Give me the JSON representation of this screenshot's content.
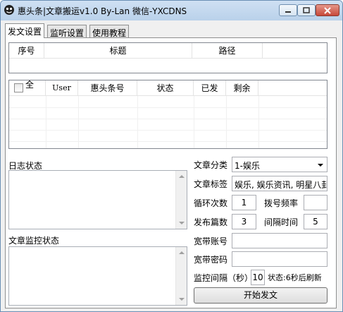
{
  "window": {
    "title": "惠头条|文章搬运v1.0 By-Lan 微信-YXCDNS"
  },
  "tabs": [
    {
      "label": "发文设置"
    },
    {
      "label": "监听设置"
    },
    {
      "label": "使用教程"
    }
  ],
  "article_list": {
    "columns": [
      "序号",
      "标题",
      "路径"
    ]
  },
  "account_list": {
    "select_all_label": "全",
    "columns": [
      "User",
      "惠头条号",
      "状态",
      "已发",
      "剩余"
    ]
  },
  "log": {
    "label": "日志状态"
  },
  "monitor_log": {
    "label": "文章监控状态"
  },
  "settings": {
    "category_label": "文章分类",
    "category_value": "1-娱乐",
    "tags_label": "文章标签",
    "tags_value": "娱乐, 娱乐资讯, 明星八卦",
    "loop_label": "循环次数",
    "loop_value": "1",
    "dial_label": "拨号频率",
    "dial_value": "",
    "publish_count_label": "发布篇数",
    "publish_count_value": "3",
    "interval_label": "间隔时间",
    "interval_value": "5",
    "broadband_account_label": "宽带账号",
    "broadband_account_value": "",
    "broadband_password_label": "宽带密码",
    "broadband_password_value": "",
    "monitor_interval_label": "监控间隔（秒）",
    "monitor_interval_value": "10",
    "status_text": "状态:6秒后刷新",
    "start_button": "开始发文"
  }
}
